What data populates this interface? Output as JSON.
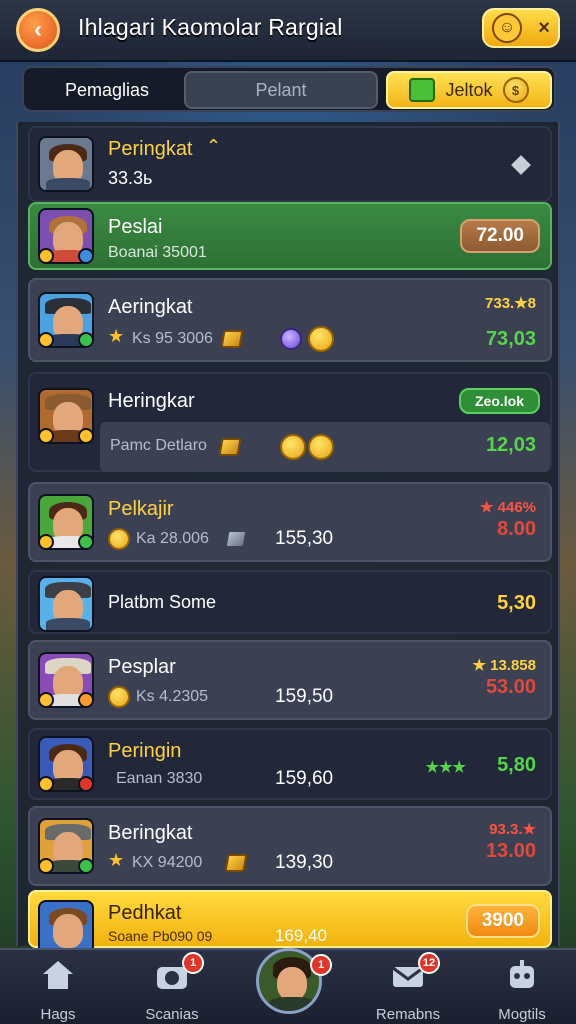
{
  "header": {
    "back_label": "‹",
    "title": "Ihlagari Kaomolar Rargial",
    "right_close": "×"
  },
  "tabs": [
    {
      "label": "Pemaglias"
    },
    {
      "label": "Pelant"
    },
    {
      "label": "Jeltok"
    }
  ],
  "rows": [
    {
      "name": "Peringkat",
      "sub": "33.3ь",
      "marker": "⌃",
      "style": "dark"
    },
    {
      "name": "Peslai",
      "sub": "Boanai 35001",
      "pill": "72.00",
      "style": "green"
    },
    {
      "name": "Aeringkat",
      "sub": "Ks 95 3006",
      "top": "733.★8",
      "value": "73,03",
      "style": "grey"
    },
    {
      "name": "Heringkar",
      "sub": "Pamc Detlaro",
      "pill": "Zeo.lok",
      "value": "12,03",
      "style": "dark-split"
    },
    {
      "name": "Pelkajir",
      "sub": "Ka 28.006",
      "mid": "155,30",
      "top": "★ 446%",
      "value": "8.00",
      "style": "grey"
    },
    {
      "name": "Platbm Some",
      "value": "5,30",
      "style": "dark"
    },
    {
      "name": "Pesplar",
      "sub": "Ks 4.2305",
      "mid": "159,50",
      "top": "★ 13.858",
      "value": "53.00",
      "style": "grey"
    },
    {
      "name": "Peringin",
      "sub": "Eanan 3830",
      "mid": "159,60",
      "top": "★★★",
      "value": "5,80",
      "style": "dark"
    },
    {
      "name": "Beringkat",
      "sub": "KX 94200",
      "mid": "139,30",
      "top": "93.3.★",
      "value": "13.00",
      "style": "grey"
    },
    {
      "name": "Pedhkat",
      "sub": "Soane Pb090 09",
      "mid": "169,40",
      "pill": "3900",
      "style": "gold"
    }
  ],
  "nav": [
    {
      "label": "Hags",
      "icon": "home-icon"
    },
    {
      "label": "Scanias",
      "icon": "camera-icon",
      "badge": "1"
    },
    {
      "label": "",
      "icon": "profile-avatar",
      "badge": "1"
    },
    {
      "label": "Remabns",
      "icon": "mail-icon",
      "badge": "12"
    },
    {
      "label": "Mogtils",
      "icon": "robot-icon"
    }
  ],
  "colors": {
    "accent_gold": "#f2b416",
    "positive": "#57d44a",
    "negative": "#e2483b",
    "highlight_row": "#3a8a43"
  }
}
